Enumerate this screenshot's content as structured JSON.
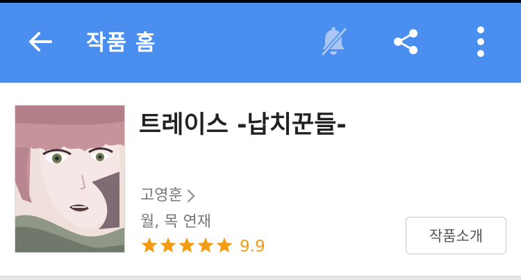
{
  "header": {
    "title": "작품 홈",
    "background_color": "#4a8ef0",
    "icons": {
      "back": "arrow-left-icon",
      "notifications": "bell-off-icon",
      "share": "share-icon",
      "more": "more-vertical-icon"
    }
  },
  "series": {
    "title": "트레이스 -납치꾼들-",
    "author": "고영훈",
    "schedule": "월, 목 연재",
    "rating": {
      "value": "9.9",
      "stars_filled": 5,
      "stars_total": 5,
      "star_color": "#f39c12"
    },
    "thumbnail_icon": "comic-cover-image"
  },
  "actions": {
    "intro_label": "작품소개"
  }
}
